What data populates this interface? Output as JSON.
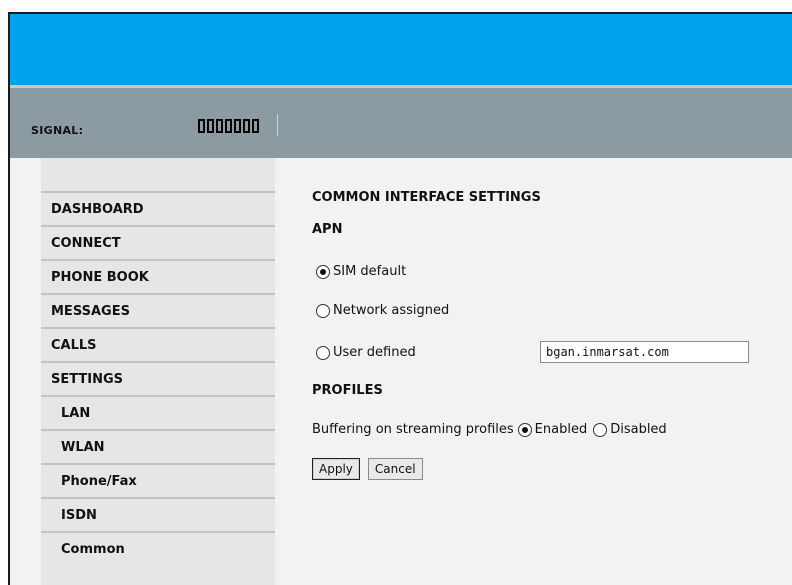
{
  "header": {
    "signal_label": "SIGNAL:",
    "signal_strength_bars": 7
  },
  "sidebar": {
    "items": [
      {
        "label": "DASHBOARD",
        "level": 0
      },
      {
        "label": "CONNECT",
        "level": 0
      },
      {
        "label": "PHONE BOOK",
        "level": 0
      },
      {
        "label": "MESSAGES",
        "level": 0
      },
      {
        "label": "CALLS",
        "level": 0
      },
      {
        "label": "SETTINGS",
        "level": 0
      },
      {
        "label": "LAN",
        "level": 1
      },
      {
        "label": "WLAN",
        "level": 1
      },
      {
        "label": "Phone/Fax",
        "level": 1
      },
      {
        "label": "ISDN",
        "level": 1
      },
      {
        "label": "Common",
        "level": 1
      }
    ]
  },
  "main": {
    "section_title": "COMMON INTERFACE SETTINGS",
    "apn_title": "APN",
    "apn_options": [
      {
        "label": "SIM default",
        "checked": true
      },
      {
        "label": "Network assigned",
        "checked": false
      },
      {
        "label": "User defined",
        "checked": false
      }
    ],
    "user_defined_value": "bgan.inmarsat.com",
    "profiles_title": "PROFILES",
    "buffering_label": "Buffering on streaming profiles",
    "buffering_options": [
      {
        "label": "Enabled",
        "checked": true
      },
      {
        "label": "Disabled",
        "checked": false
      }
    ],
    "apply_label": "Apply",
    "cancel_label": "Cancel"
  },
  "colors": {
    "topbar": "#00a2ee",
    "signalbar": "#8c9aa2",
    "sidebar": "#e6e6e6",
    "background": "#f2f2f2"
  }
}
